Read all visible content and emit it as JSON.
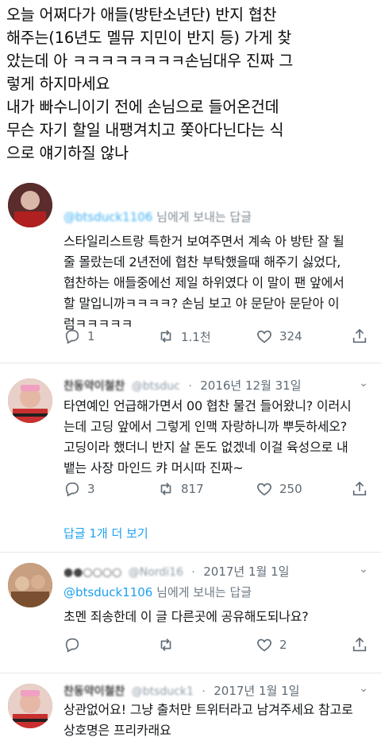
{
  "header": {
    "lines": [
      "오늘 어쩌다가 애들(방탄소년단) 반지 협찬",
      "해주는(16년도 멜뮤 지민이 반지 등) 가게 찾",
      "았는데 아 ㅋㅋㅋㅋㅋㅋㅋㅋ손님대우 진짜 그",
      "렇게 하지마세요",
      "내가 빠수니이기 전에 손님으로 들어온건데",
      "무슨 자기 할일 내팽겨치고 쫓아다닌다는 식",
      "으로 얘기하질 않나"
    ]
  },
  "tweets": [
    {
      "reply_handle": "@btsduck1106",
      "reply_suffix": "님에게 보내는 답글",
      "body": [
        "스타일리스트랑 특한거 보여주면서 계속 아 방탄 잘 될",
        "줄 몰랐는데 2년전에 협찬 부탁했을때 해주기 싫었다,",
        "협찬하는 애들중에선 제일 하위였다 이 말이 팬 앞에서",
        "할 말입니까ㅋㅋㅋㅋ? 손님 보고 야 문닫아 문닫아 이",
        "럼ㅋㅋㅋㅋㅋ"
      ],
      "replies": "1",
      "retweets": "1.1천",
      "likes": "324"
    },
    {
      "name": "찬동약이철찬",
      "handle": "@btsduc",
      "date": "2016년 12월 31일",
      "body": [
        "타연예인 언급해가면서 00 협찬 물건 들어왔니? 이러시",
        "는데 고딩 앞에서 그렇게 인맥 자랑하니까 뿌듯하세오?",
        "고딩이라 했더니 반지 살 돈도 없겠네 이걸 육성으로 내",
        "뱉는 사장 마인드 캬 머시따 진짜~"
      ],
      "replies": "3",
      "retweets": "817",
      "likes": "250",
      "more_replies": "답글 1개 더 보기"
    },
    {
      "name": "●●○○○○",
      "handle": "@Nordi16",
      "date": "2017년 1월 1일",
      "reply_handle": "@btsduck1106",
      "reply_suffix": "님에게 보내는 답글",
      "body": [
        "초멘 죄송한데 이 글 다른곳에 공유해도되나요?"
      ],
      "replies": "",
      "retweets": "",
      "likes": "2"
    },
    {
      "name": "찬동약이철찬",
      "handle": "@btsduck1",
      "date": "2017년 1월 1일",
      "body": [
        "상관없어요! 그냥 출처만 트위터라고 남겨주세요 참고로",
        "상호명은 프리카래요"
      ]
    }
  ],
  "colors": {
    "accent": "#1da1f2",
    "text": "#15181b",
    "muted": "#5f6b75"
  }
}
